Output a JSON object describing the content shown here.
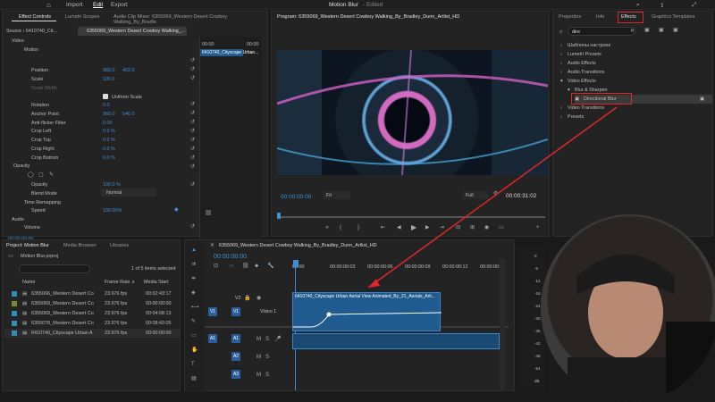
{
  "app": {
    "title": "Motion Blur",
    "status": "- Edited"
  },
  "menu": {
    "import": "Import",
    "edit": "Edit",
    "export": "Export"
  },
  "effect_controls": {
    "tabs": [
      "Effect Controls",
      "Lumetri Scopes",
      "Audio Clip Mixer: 6355069_Western Desert Cowboy Walking_By_Bradle"
    ],
    "source_label": "Source › 6410740_Cit...",
    "clip_label": "6355069_Western Desert Cowboy Walking_...",
    "mini_timecode": "00:00",
    "mini_clip": "6410740_Cityscape Urban...",
    "section_video": "Video",
    "motion": "Motion",
    "position": {
      "label": "Position",
      "x": "960.0",
      "y": "402.0"
    },
    "scale": {
      "label": "Scale",
      "value": "100.0"
    },
    "scale_width": {
      "label": "Scale Width"
    },
    "uniform_scale": "Uniform Scale",
    "rotation": {
      "label": "Rotation",
      "value": "0.0"
    },
    "anchor": {
      "label": "Anchor Point",
      "x": "960.0",
      "y": "540.0"
    },
    "antiflicker": {
      "label": "Anti-flicker Filter",
      "value": "0.00"
    },
    "crop_left": {
      "label": "Crop Left",
      "value": "0.0 %"
    },
    "crop_top": {
      "label": "Crop Top",
      "value": "0.0 %"
    },
    "crop_right": {
      "label": "Crop Right",
      "value": "0.0 %"
    },
    "crop_bottom": {
      "label": "Crop Bottom",
      "value": "0.0 %"
    },
    "opacity_section": "Opacity",
    "opacity": {
      "label": "Opacity",
      "value": "100.0 %"
    },
    "blend": {
      "label": "Blend Mode",
      "value": "Normal"
    },
    "time_remap": "Time Remapping",
    "speed": {
      "label": "Speed",
      "value": "100.00%"
    },
    "section_audio": "Audio",
    "volume": "Volume",
    "timecode": "00:00:00:00"
  },
  "program": {
    "title": "Program: 6355069_Western Desert Cowboy Walking_By_Bradley_Dunn_Artlist_HD",
    "timecode": "00:00:00:00",
    "fit": "Fit",
    "full": "Full",
    "duration": "00:00:31:02"
  },
  "effects_panel": {
    "tabs": [
      "Properties",
      "Info",
      "Effects",
      "Graphics Templates"
    ],
    "search_value": "dire",
    "tree": [
      {
        "label": "Шаблоны настроек",
        "level": 0
      },
      {
        "label": "Lumetri Presets",
        "level": 0
      },
      {
        "label": "Audio Effects",
        "level": 0
      },
      {
        "label": "Audio Transitions",
        "level": 0
      },
      {
        "label": "Video Effects",
        "level": 0,
        "open": true
      },
      {
        "label": "Blur & Sharpen",
        "level": 1,
        "open": true
      },
      {
        "label": "Directional Blur",
        "level": 2,
        "selected": true
      },
      {
        "label": "Video Transitions",
        "level": 0
      },
      {
        "label": "Presets",
        "level": 0
      }
    ]
  },
  "project": {
    "tabs": [
      "Project: Motion Blur",
      "Media Browser",
      "Libraries"
    ],
    "file": "Motion Blur.prproj",
    "selected_count": "1 of 5 items selected",
    "columns": [
      "Name",
      "Frame Rate ∧",
      "Media Start"
    ],
    "rows": [
      {
        "name": "6355066_Western Desert Co",
        "fps": "23.976 fps",
        "start": "00:02:43:17",
        "color": "#2f8fb6"
      },
      {
        "name": "6355069_Western Desert Co",
        "fps": "23.976 fps",
        "start": "00:00:00:00",
        "color": "#7a8a2a"
      },
      {
        "name": "6355069_Western Desert Co",
        "fps": "23.976 fps",
        "start": "00:04:08:13",
        "color": "#2f8fb6"
      },
      {
        "name": "6355078_Western Desert Co",
        "fps": "23.976 fps",
        "start": "00:08:42:05",
        "color": "#2f8fb6"
      },
      {
        "name": "6410740_Cityscape Urban A",
        "fps": "23.976 fps",
        "start": "00:00:00:00",
        "color": "#2f8fb6"
      }
    ]
  },
  "timeline": {
    "title": "6355069_Western Desert Cowboy Walking_By_Bradley_Dunn_Artlist_HD",
    "timecode": "00:00:00:00",
    "ruler": [
      "00:00",
      "00:00:00:03",
      "00:00:00:06",
      "00:00:00:09",
      "00:00:00:12",
      "00:00:00:15"
    ],
    "clip_label": "6410740_Cityscape Urban Aerial View Animated_By_21_Aerials_Arti...",
    "tracks_v": [
      "V2",
      "V1"
    ],
    "track_v1_name": "Video 1",
    "tracks_a": [
      "A1",
      "A2",
      "A3"
    ],
    "track_btn": "V1"
  },
  "meter": {
    "labels": [
      "0",
      "-6",
      "-12",
      "-18",
      "-24",
      "-30",
      "-36",
      "-42",
      "-48",
      "-54",
      "dB"
    ]
  },
  "colors": {
    "accent": "#3d8fd6",
    "highlight": "#e0262d",
    "clip": "#1f5b8e"
  }
}
